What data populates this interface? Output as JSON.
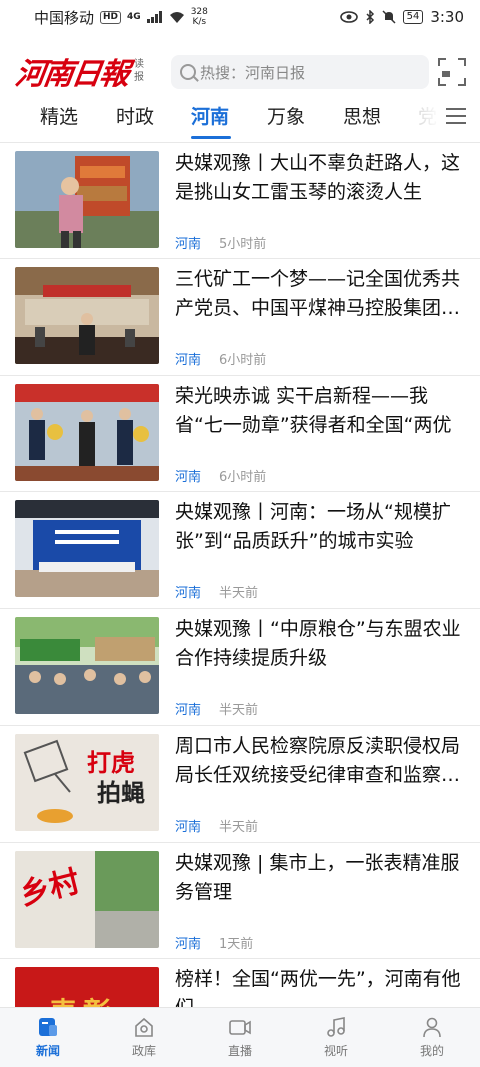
{
  "status_bar": {
    "carrier": "中国移动",
    "hd": "HD",
    "signal": "4G",
    "net_speed_value": "328",
    "net_speed_unit": "K/s",
    "battery": "54",
    "time": "3:30"
  },
  "header": {
    "logo_text": "河南日報",
    "logo_sub": "读报",
    "search_placeholder": "热搜：河南日报"
  },
  "tabs": [
    {
      "label": "精选",
      "active": false
    },
    {
      "label": "时政",
      "active": false
    },
    {
      "label": "河南",
      "active": true
    },
    {
      "label": "万象",
      "active": false
    },
    {
      "label": "思想",
      "active": false
    },
    {
      "label": "党",
      "active": false
    }
  ],
  "news": [
    {
      "title": "央媒观豫丨大山不辜负赶路人，这是挑山女工雷玉琴的滚烫人生",
      "source": "河南",
      "time": "5小时前"
    },
    {
      "title": "三代矿工一个梦——记全国优秀共产党员、中国平煤神马控股集团…",
      "source": "河南",
      "time": "6小时前"
    },
    {
      "title": "荣光映赤诚 实干启新程——我省“七一勋章”获得者和全国“两优一先”…",
      "source": "河南",
      "time": "6小时前"
    },
    {
      "title": "央媒观豫丨河南：一场从“规模扩张”到“品质跃升”的城市实验",
      "source": "河南",
      "time": "半天前"
    },
    {
      "title": "央媒观豫丨“中原粮仓”与东盟农业合作持续提质升级",
      "source": "河南",
      "time": "半天前"
    },
    {
      "title": "周口市人民检察院原反渎职侵权局局长任双统接受纪律审查和监察…",
      "source": "河南",
      "time": "半天前"
    },
    {
      "title": "央媒观豫 | 集市上，一张表精准服务管理",
      "source": "河南",
      "time": "1天前"
    },
    {
      "title": "榜样！全国“两优一先”，河南有他们",
      "source": "",
      "time": ""
    }
  ],
  "thumb_text": {
    "tiger_line1": "打虎",
    "tiger_line2": "拍蝇",
    "village": "乡村",
    "honor": "表彰"
  },
  "bottom_nav": [
    {
      "label": "新闻",
      "icon": "news-icon",
      "active": true
    },
    {
      "label": "政库",
      "icon": "library-icon",
      "active": false
    },
    {
      "label": "直播",
      "icon": "live-icon",
      "active": false
    },
    {
      "label": "视听",
      "icon": "music-icon",
      "active": false
    },
    {
      "label": "我的",
      "icon": "user-icon",
      "active": false
    }
  ],
  "colors": {
    "brand_red": "#d7000f",
    "accent_blue": "#1b6fd8"
  }
}
